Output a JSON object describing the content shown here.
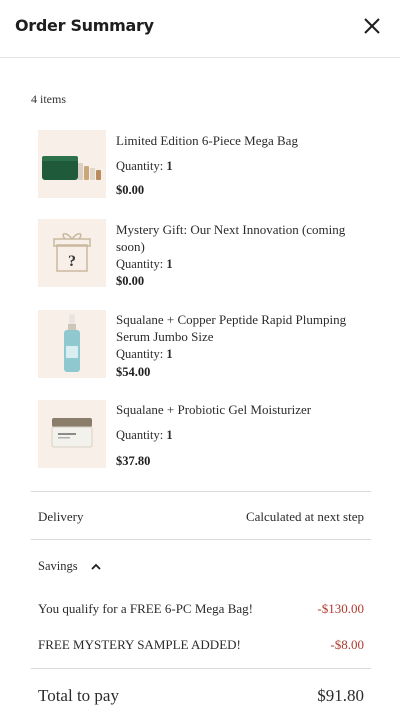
{
  "header": {
    "title": "Order Summary"
  },
  "summary": {
    "item_count": "4 items"
  },
  "items": [
    {
      "name": "Limited Edition 6-Piece Mega Bag",
      "qty_label": "Quantity: ",
      "qty": "1",
      "price": "$0.00",
      "icon": "green-bag-with-bottles"
    },
    {
      "name": "Mystery Gift: Our Next Innovation (coming soon)",
      "qty_label": "Quantity: ",
      "qty": "1",
      "price": "$0.00",
      "icon": "gift-box-question-mark"
    },
    {
      "name": "Squalane + Copper Peptide Rapid Plumping Serum Jumbo Size",
      "qty_label": "Quantity: ",
      "qty": "1",
      "price": "$54.00",
      "icon": "serum-bottle"
    },
    {
      "name": "Squalane + Probiotic Gel Moisturizer",
      "qty_label": "Quantity: ",
      "qty": "1",
      "price": "$37.80",
      "icon": "moisturizer-jar"
    }
  ],
  "delivery": {
    "label": "Delivery",
    "value": "Calculated at next step"
  },
  "savings": {
    "label": "Savings",
    "lines": [
      {
        "label": "You qualify for a FREE 6-PC Mega Bag!",
        "value": "-$130.00"
      },
      {
        "label": "FREE MYSTERY SAMPLE ADDED!",
        "value": "-$8.00"
      }
    ]
  },
  "total": {
    "label": "Total to pay",
    "value": "$91.80"
  },
  "colors": {
    "thumb_bg": "#f7efe8",
    "discount": "#b03a2e",
    "divider": "#d9d9d9"
  }
}
